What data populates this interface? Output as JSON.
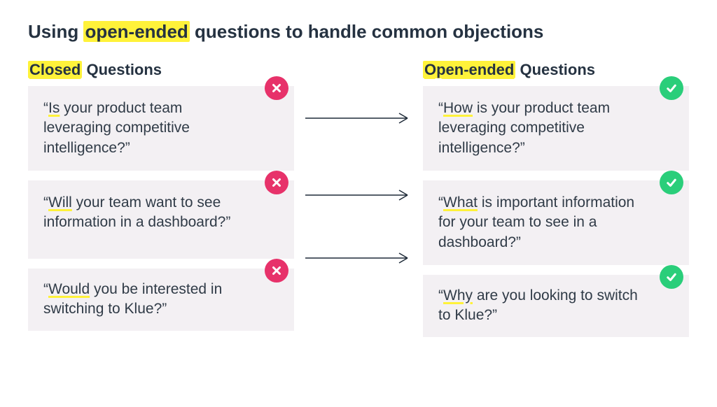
{
  "title_pre": "Using ",
  "title_hl": "open-ended",
  "title_post": " questions to handle common objections",
  "col_left_header_hl": "Closed",
  "col_left_header_rest": " Questions",
  "col_right_header_hl": "Open-ended",
  "col_right_header_rest": " Questions",
  "rows": [
    {
      "closed_q": "“",
      "closed_underline": "Is",
      "closed_rest": " your product team leveraging competitive intelligence?”",
      "open_q": "“",
      "open_underline": "How",
      "open_rest": " is your product team leveraging competitive intelligence?”"
    },
    {
      "closed_q": "“",
      "closed_underline": "Will",
      "closed_rest": " your team want to see information in a dashboard?”",
      "open_q": "“",
      "open_underline": "What",
      "open_rest": " is important information for your team to see in a dashboard?”"
    },
    {
      "closed_q": "“",
      "closed_underline": "Would",
      "closed_rest": " you be interested in switching to Klue?”",
      "open_q": "“",
      "open_underline": "Why",
      "open_rest": " are you looking to switch to Klue?”"
    }
  ]
}
